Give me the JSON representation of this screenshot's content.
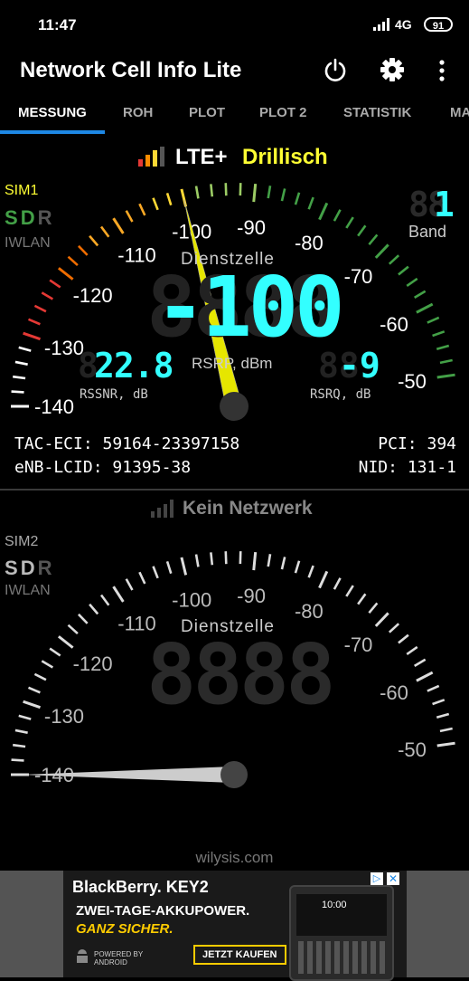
{
  "status_bar": {
    "time": "11:47",
    "network": "4G",
    "battery": "91"
  },
  "app": {
    "title": "Network Cell Info Lite"
  },
  "tabs": [
    "MESSUNG",
    "ROH",
    "PLOT",
    "PLOT 2",
    "STATISTIK",
    "MA"
  ],
  "sim1": {
    "technology": "LTE+",
    "operator": "Drillisch",
    "sim_label": "SIM1",
    "sdr": [
      "S",
      "D",
      "R"
    ],
    "iwlan": "IWLAN",
    "band_label": "Band",
    "band_value": "1",
    "dienstzelle": "Dienstzelle",
    "rsrp_value": "-100",
    "rsrp_label": "RSRP, dBm",
    "rssnr_value": "22.8",
    "rssnr_label": "RSSNR, dB",
    "rsrq_value": "-9",
    "rsrq_label": "RSRQ, dB",
    "scale": [
      "-140",
      "-130",
      "-120",
      "-110",
      "-100",
      "-90",
      "-80",
      "-70",
      "-60",
      "-50"
    ],
    "needle_value": -100,
    "tac_eci_label": "TAC-ECI:",
    "tac_eci": "59164-23397158",
    "enb_lcid_label": "eNB-LCID:",
    "enb_lcid": "91395-38",
    "pci_label": "PCI:",
    "pci": "394",
    "nid_label": "NID:",
    "nid": "131-1"
  },
  "sim2": {
    "status": "Kein Netzwerk",
    "sim_label": "SIM2",
    "sdr": [
      "S",
      "D",
      "R"
    ],
    "iwlan": "IWLAN",
    "dienstzelle": "Dienstzelle",
    "scale": [
      "-140",
      "-130",
      "-120",
      "-110",
      "-100",
      "-90",
      "-80",
      "-70",
      "-60",
      "-50"
    ],
    "needle_value": -140
  },
  "footer": {
    "credit": "wilysis.com"
  },
  "ad": {
    "brand": "BlackBerry. KEY2",
    "headline": "ZWEI-TAGE-AKKUPOWER.",
    "subline": "GANZ SICHER.",
    "powered": "POWERED BY ANDROID",
    "cta": "JETZT KAUFEN",
    "phone_time": "10:00"
  }
}
